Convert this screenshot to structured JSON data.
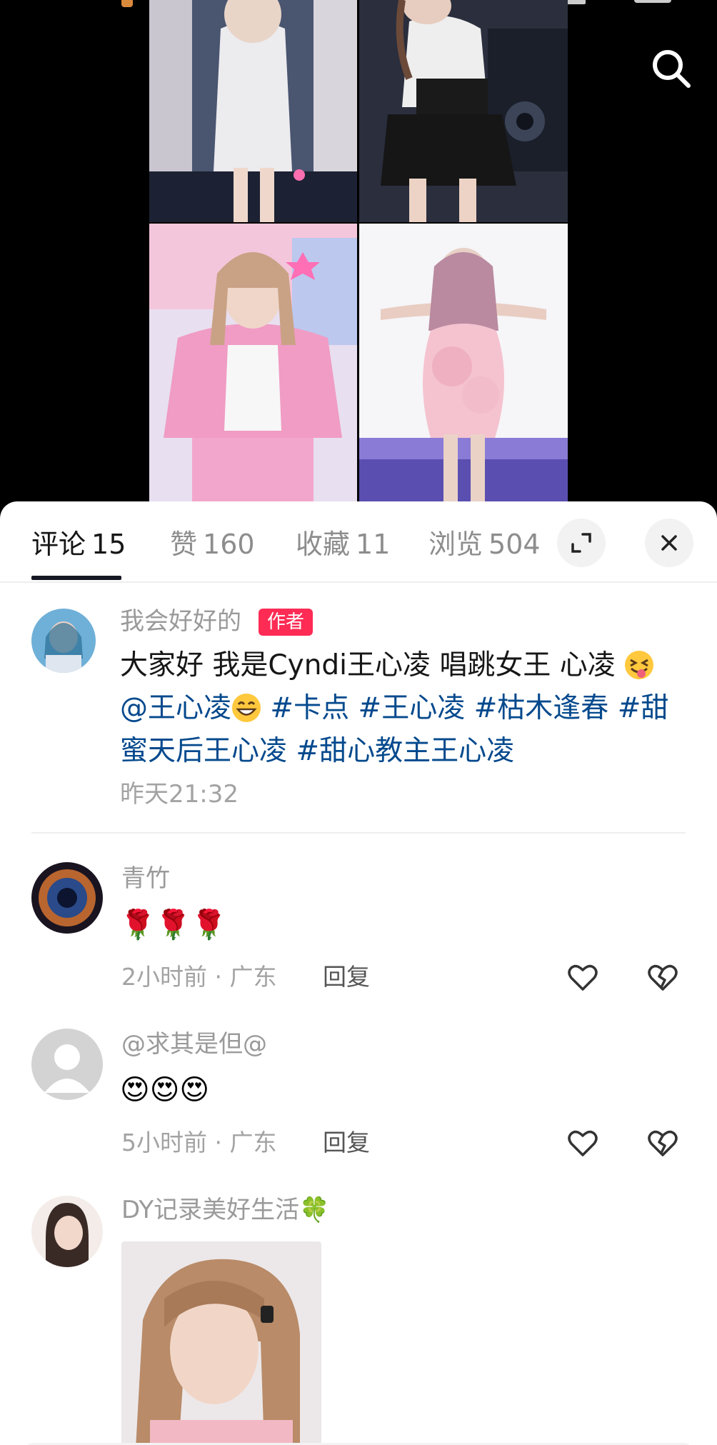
{
  "tabs": [
    {
      "label": "评论",
      "count": "15"
    },
    {
      "label": "赞",
      "count": "160"
    },
    {
      "label": "收藏",
      "count": "11"
    },
    {
      "label": "浏览",
      "count": "504"
    }
  ],
  "post": {
    "author": "我会好好的",
    "badge": "作者",
    "text_intro": "大家好 我是Cyndi王心凌 唱跳女王 心凌",
    "mention": "@王心凌",
    "hashtags": [
      "#卡点",
      "#王心凌",
      "#枯木逢春",
      "#甜蜜天后王心凌",
      "#甜心教主王心凌"
    ],
    "time": "昨天21:32"
  },
  "comments": [
    {
      "user": "青竹",
      "content": "🌹🌹🌹",
      "time": "2小时前",
      "location": "广东",
      "reply": "回复"
    },
    {
      "user": "@求其是但@",
      "content": "😍😍😍",
      "time": "5小时前",
      "location": "广东",
      "reply": "回复"
    },
    {
      "user": "DY记录美好生活🍀",
      "content": "",
      "time": "",
      "location": "",
      "reply": ""
    }
  ],
  "colors": {
    "accent": "#fe2c55",
    "hashtag": "#04498d",
    "muted": "#a3a3a3"
  },
  "icons": [
    "search-icon",
    "expand-icon",
    "close-icon",
    "heart-icon",
    "broken-heart-icon"
  ]
}
